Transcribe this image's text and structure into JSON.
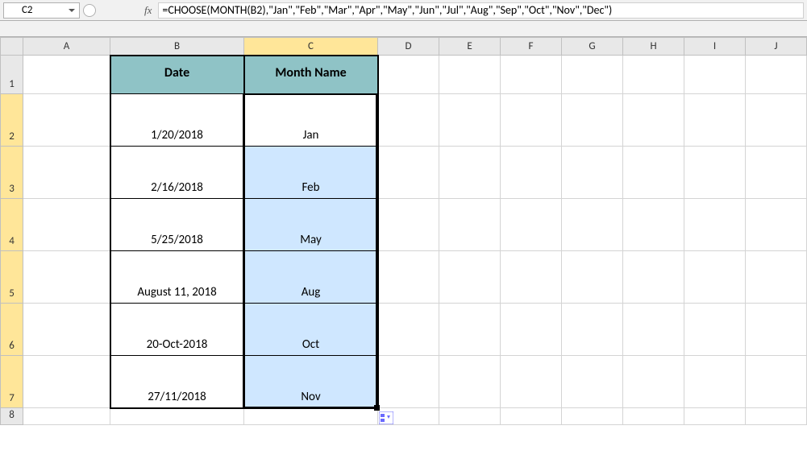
{
  "nameBox": {
    "value": "C2"
  },
  "fx": {
    "label": "fx"
  },
  "formula": {
    "text": "=CHOOSE(MONTH(B2),\"Jan\",\"Feb\",\"Mar\",\"Apr\",\"May\",\"Jun\",\"Jul\",\"Aug\",\"Sep\",\"Oct\",\"Nov\",\"Dec\")"
  },
  "columns": {
    "A": "A",
    "B": "B",
    "C": "C",
    "D": "D",
    "E": "E",
    "F": "F",
    "G": "G",
    "H": "H",
    "I": "I",
    "J": "J"
  },
  "rows": {
    "r1": "1",
    "r2": "2",
    "r3": "3",
    "r4": "4",
    "r5": "5",
    "r6": "6",
    "r7": "7",
    "r8": "8"
  },
  "headers": {
    "date": "Date",
    "month": "Month Name"
  },
  "data": {
    "b2": "1/20/2018",
    "c2": "Jan",
    "b3": "2/16/2018",
    "c3": "Feb",
    "b4": "5/25/2018",
    "c4": "May",
    "b5": "August 11, 2018",
    "c5": "Aug",
    "b6": "20-Oct-2018",
    "c6": "Oct",
    "b7": "27/11/2018",
    "c7": "Nov"
  },
  "chart_data": {
    "type": "table",
    "title": "",
    "columns": [
      "Date",
      "Month Name"
    ],
    "rows": [
      [
        "1/20/2018",
        "Jan"
      ],
      [
        "2/16/2018",
        "Feb"
      ],
      [
        "5/25/2018",
        "May"
      ],
      [
        "August 11, 2018",
        "Aug"
      ],
      [
        "20-Oct-2018",
        "Oct"
      ],
      [
        "27/11/2018",
        "Nov"
      ]
    ]
  }
}
